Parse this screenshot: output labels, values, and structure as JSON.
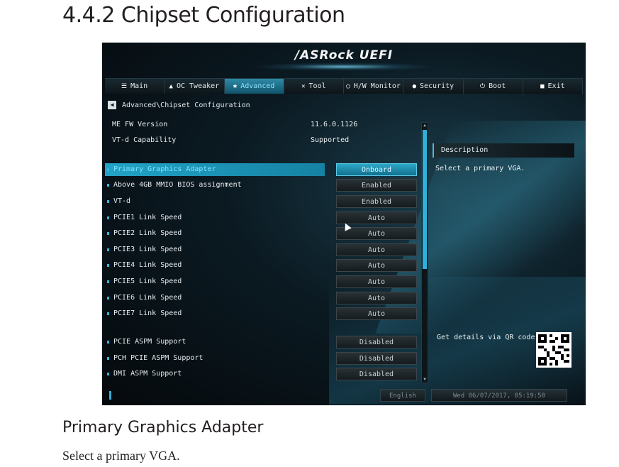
{
  "document": {
    "heading": "4.4.2  Chipset Configuration",
    "subheading": "Primary Graphics Adapter",
    "body": "Select a primary VGA."
  },
  "bios": {
    "brand": "/ASRock UEFI",
    "menu": [
      {
        "label": "Main",
        "icon": "list-icon",
        "active": false
      },
      {
        "label": "OC Tweaker",
        "icon": "person-icon",
        "active": false
      },
      {
        "label": "Advanced",
        "icon": "star-icon",
        "active": true
      },
      {
        "label": "Tool",
        "icon": "tool-icon",
        "active": false
      },
      {
        "label": "H/W Monitor",
        "icon": "monitor-icon",
        "active": false
      },
      {
        "label": "Security",
        "icon": "shield-icon",
        "active": false
      },
      {
        "label": "Boot",
        "icon": "power-icon",
        "active": false
      },
      {
        "label": "Exit",
        "icon": "exit-icon",
        "active": false
      }
    ],
    "breadcrumb": "Advanced\\Chipset Configuration",
    "info": [
      {
        "label": "ME FW Version",
        "value": "11.6.0.1126"
      },
      {
        "label": "VT-d Capability",
        "value": "Supported"
      }
    ],
    "options": [
      {
        "label": "Primary Graphics Adapter",
        "value": "Onboard",
        "selected": true
      },
      {
        "label": "Above 4GB MMIO BIOS assignment",
        "value": "Enabled",
        "selected": false
      },
      {
        "label": "VT-d",
        "value": "Enabled",
        "selected": false
      },
      {
        "label": "PCIE1 Link Speed",
        "value": "Auto",
        "selected": false
      },
      {
        "label": "PCIE2 Link Speed",
        "value": "Auto",
        "selected": false
      },
      {
        "label": "PCIE3 Link Speed",
        "value": "Auto",
        "selected": false
      },
      {
        "label": "PCIE4 Link Speed",
        "value": "Auto",
        "selected": false
      },
      {
        "label": "PCIE5 Link Speed",
        "value": "Auto",
        "selected": false
      },
      {
        "label": "PCIE6 Link Speed",
        "value": "Auto",
        "selected": false
      },
      {
        "label": "PCIE7 Link Speed",
        "value": "Auto",
        "selected": false
      },
      {
        "label": "PCIE ASPM Support",
        "value": "Disabled",
        "selected": false
      },
      {
        "label": "PCH PCIE ASPM Support",
        "value": "Disabled",
        "selected": false
      },
      {
        "label": "DMI ASPM Support",
        "value": "Disabled",
        "selected": false
      }
    ],
    "description": {
      "title": "Description",
      "text": "Select a primary VGA.",
      "qr_label": "Get details via QR code"
    },
    "status": {
      "language": "English",
      "datetime": "Wed 06/07/2017, 05:19:50"
    },
    "colors": {
      "accent": "#2fb1da",
      "selected_row": "#22a3c6",
      "background": "#0b1a22"
    }
  }
}
